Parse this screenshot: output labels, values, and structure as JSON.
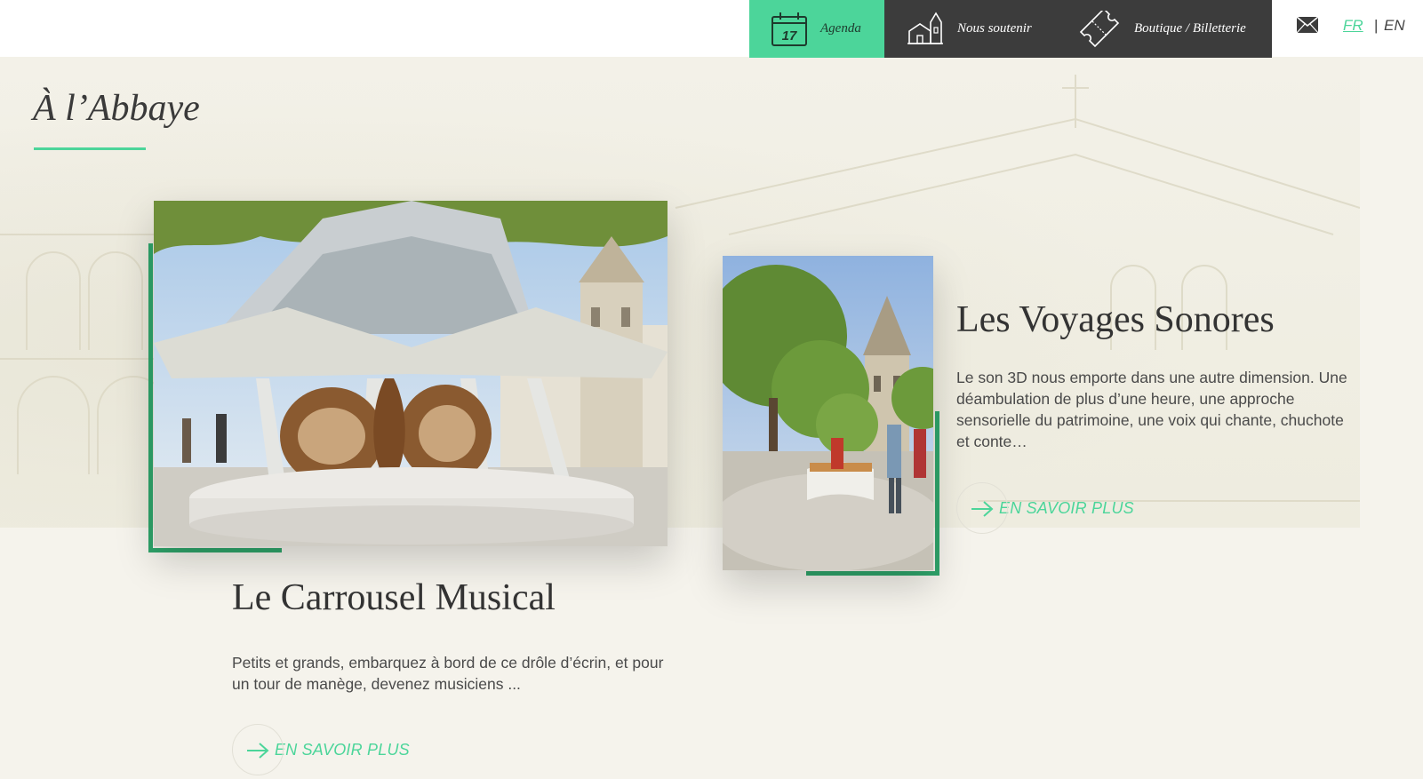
{
  "nav": {
    "agenda": {
      "label": "Agenda",
      "day": "17"
    },
    "soutenir": {
      "label": "Nous soutenir"
    },
    "boutique": {
      "label": "Boutique / Billetterie"
    },
    "languages": {
      "fr": "FR",
      "separator": "|",
      "en": "EN",
      "active": "FR"
    }
  },
  "section": {
    "title": "À l’Abbaye"
  },
  "cards": [
    {
      "title": "Le Carrousel Musical",
      "text": "Petits et grands, embarquez à bord de ce drôle d’écrin, et pour un tour de manège, devenez musiciens ...",
      "cta": "EN SAVOIR PLUS"
    },
    {
      "title": "Les Voyages Sonores",
      "text": "Le son 3D nous emporte dans une autre dimension. Une déambulation de plus d’une heure, une approche sensorielle du patrimoine, une voix qui chante, chuchote et conte…",
      "cta": "EN SAVOIR PLUS"
    }
  ],
  "colors": {
    "accent": "#4cd59a",
    "frame": "#2fa56b",
    "nav_dark": "#3c3c3c",
    "background": "#f5f3ec"
  },
  "icons": [
    "calendar-icon",
    "church-icon",
    "ticket-icon",
    "mail-icon",
    "arrow-right-icon"
  ]
}
